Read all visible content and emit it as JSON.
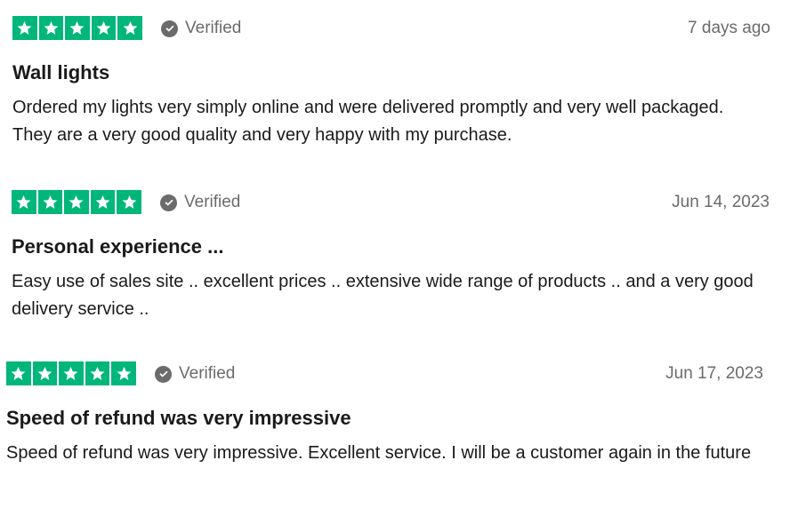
{
  "reviews": [
    {
      "rating": 5,
      "verified_label": "Verified",
      "date": "7 days ago",
      "title": "Wall lights",
      "body": "Ordered my lights very simply online and were delivered promptly and very well packaged. They are a very good quality and very happy with my purchase."
    },
    {
      "rating": 5,
      "verified_label": "Verified",
      "date": "Jun 14, 2023",
      "title": "Personal experience ...",
      "body": "Easy use of sales site .. excellent prices .. extensive wide range of products .. and a very good delivery service .."
    },
    {
      "rating": 5,
      "verified_label": "Verified",
      "date": "Jun 17, 2023",
      "title": "Speed of refund was very impressive",
      "body": "Speed of refund was very impressive. Excellent service. I will be a customer again in the future"
    }
  ],
  "colors": {
    "star_green": "#00b67a",
    "muted_text": "#6b6b6b",
    "main_text": "#1a1a1a"
  },
  "icons": {
    "star": "star-icon",
    "verified": "verified-check-icon"
  }
}
